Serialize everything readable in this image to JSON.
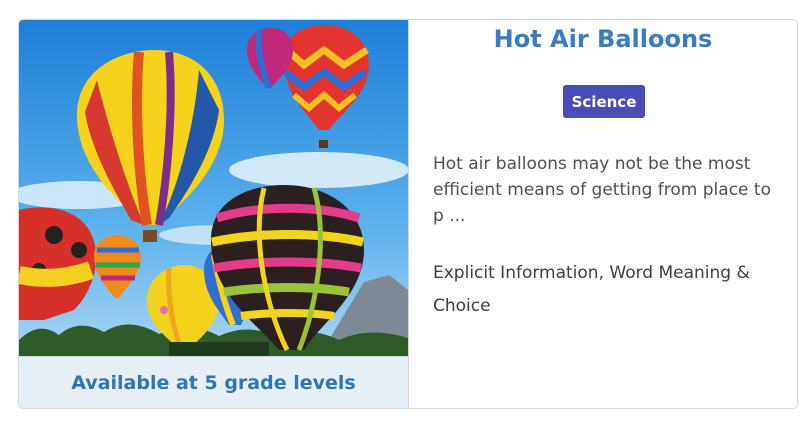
{
  "card": {
    "title": "Hot Air Balloons",
    "category": "Science",
    "description": "Hot air balloons may not be the most efficient means of getting from place to p ...",
    "skills": "Explicit Information, Word Meaning & Choice",
    "availability": "Available at 5 grade levels",
    "image_alt": "Hot air balloons",
    "colors": {
      "title": "#3a7dc0",
      "badge": "#4a4db8",
      "availability_bg": "#e6eff6",
      "availability_text": "#2f75b5"
    }
  }
}
